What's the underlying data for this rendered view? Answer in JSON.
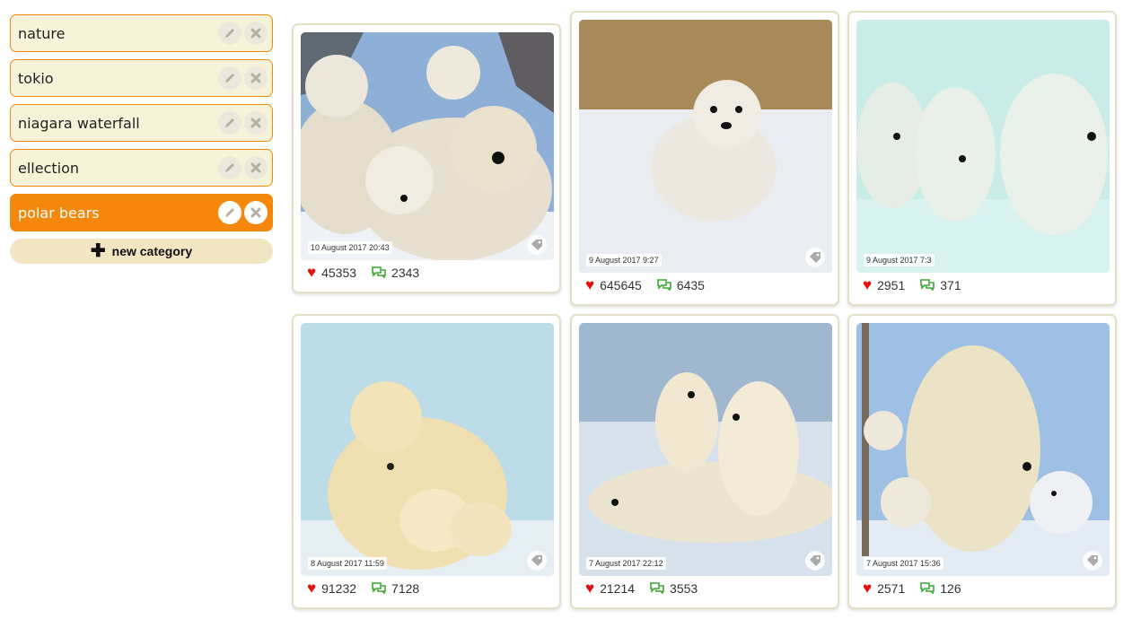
{
  "categories": [
    {
      "label": "nature",
      "active": false
    },
    {
      "label": "tokio",
      "active": false
    },
    {
      "label": "niagara waterfall",
      "active": false
    },
    {
      "label": "ellection",
      "active": false
    },
    {
      "label": "polar bears",
      "active": true
    }
  ],
  "new_category_label": "new category",
  "posts": [
    {
      "date": "10 August 2017 20:43",
      "likes": "45353",
      "comments": "2343"
    },
    {
      "date": "9 August 2017 9:27",
      "likes": "645645",
      "comments": "6435"
    },
    {
      "date": "9 August 2017 7:3",
      "likes": "2951",
      "comments": "371"
    },
    {
      "date": "8 August 2017 11:59",
      "likes": "91232",
      "comments": "7128"
    },
    {
      "date": "7 August 2017 22:12",
      "likes": "21214",
      "comments": "3553"
    },
    {
      "date": "7 August 2017 15:36",
      "likes": "2571",
      "comments": "126"
    }
  ],
  "colors": {
    "accent": "#f5870c",
    "category_bg": "#f7f3d9",
    "like": "#e40e0e",
    "comment": "#3aa832"
  },
  "icons": {
    "edit": "pencil-icon",
    "delete": "close-icon",
    "add": "plus-icon",
    "like": "heart-icon",
    "comment": "comments-icon",
    "tag": "tag-icon"
  }
}
